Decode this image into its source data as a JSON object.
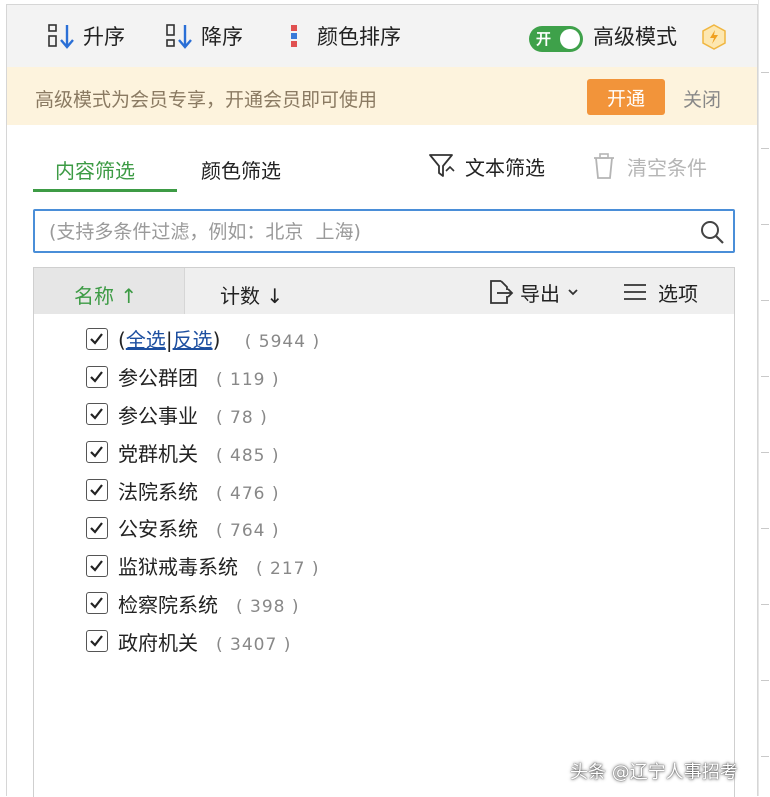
{
  "toolbar": {
    "sort_asc": "升序",
    "sort_desc": "降序",
    "color_sort": "颜色排序",
    "toggle_label": "开",
    "advanced_mode": "高级模式"
  },
  "banner": {
    "text": "高级模式为会员专享，开通会员即可使用",
    "open": "开通",
    "close": "关闭"
  },
  "tabs": {
    "content_filter": "内容筛选",
    "color_filter": "颜色筛选",
    "text_filter": "文本筛选",
    "clear_conditions": "清空条件"
  },
  "search": {
    "placeholder": "(支持多条件过滤，例如：北京  上海)"
  },
  "list_header": {
    "name": "名称",
    "name_arrow": "↑",
    "count": "计数",
    "count_arrow": "↓",
    "export": "导出",
    "options": "选项"
  },
  "select_all": {
    "open_paren": "(",
    "all": "全选",
    "sep": "|",
    "invert": "反选",
    "close_paren": ")",
    "count": "( 5944 )",
    "checked": true
  },
  "items": [
    {
      "label": "参公群团",
      "count": "( 119 )",
      "checked": true
    },
    {
      "label": "参公事业",
      "count": "( 78 )",
      "checked": true
    },
    {
      "label": "党群机关",
      "count": "( 485 )",
      "checked": true
    },
    {
      "label": "法院系统",
      "count": "( 476 )",
      "checked": true
    },
    {
      "label": "公安系统",
      "count": "( 764 )",
      "checked": true
    },
    {
      "label": "监狱戒毒系统",
      "count": "( 217 )",
      "checked": true
    },
    {
      "label": "检察院系统",
      "count": "( 398 )",
      "checked": true
    },
    {
      "label": "政府机关",
      "count": "( 3407 )",
      "checked": true
    }
  ],
  "watermark": "头条 @辽宁人事招考",
  "colors": {
    "accent_green": "#3d9b45",
    "toggle_green": "#3ea14a",
    "open_button_orange": "#f2943a",
    "banner_bg": "#fdf3dd",
    "search_border": "#4a8ed8",
    "link_blue": "#1d4fa0"
  },
  "icons": {
    "sort_asc": "sort-ascending-icon",
    "sort_desc": "sort-descending-icon",
    "color_sort": "color-sort-icon",
    "bolt": "lightning-badge-icon",
    "filter": "funnel-icon",
    "clear": "trash-icon",
    "search": "search-icon",
    "export": "export-icon",
    "options": "menu-lines-icon",
    "checkbox": "checkmark-icon"
  }
}
